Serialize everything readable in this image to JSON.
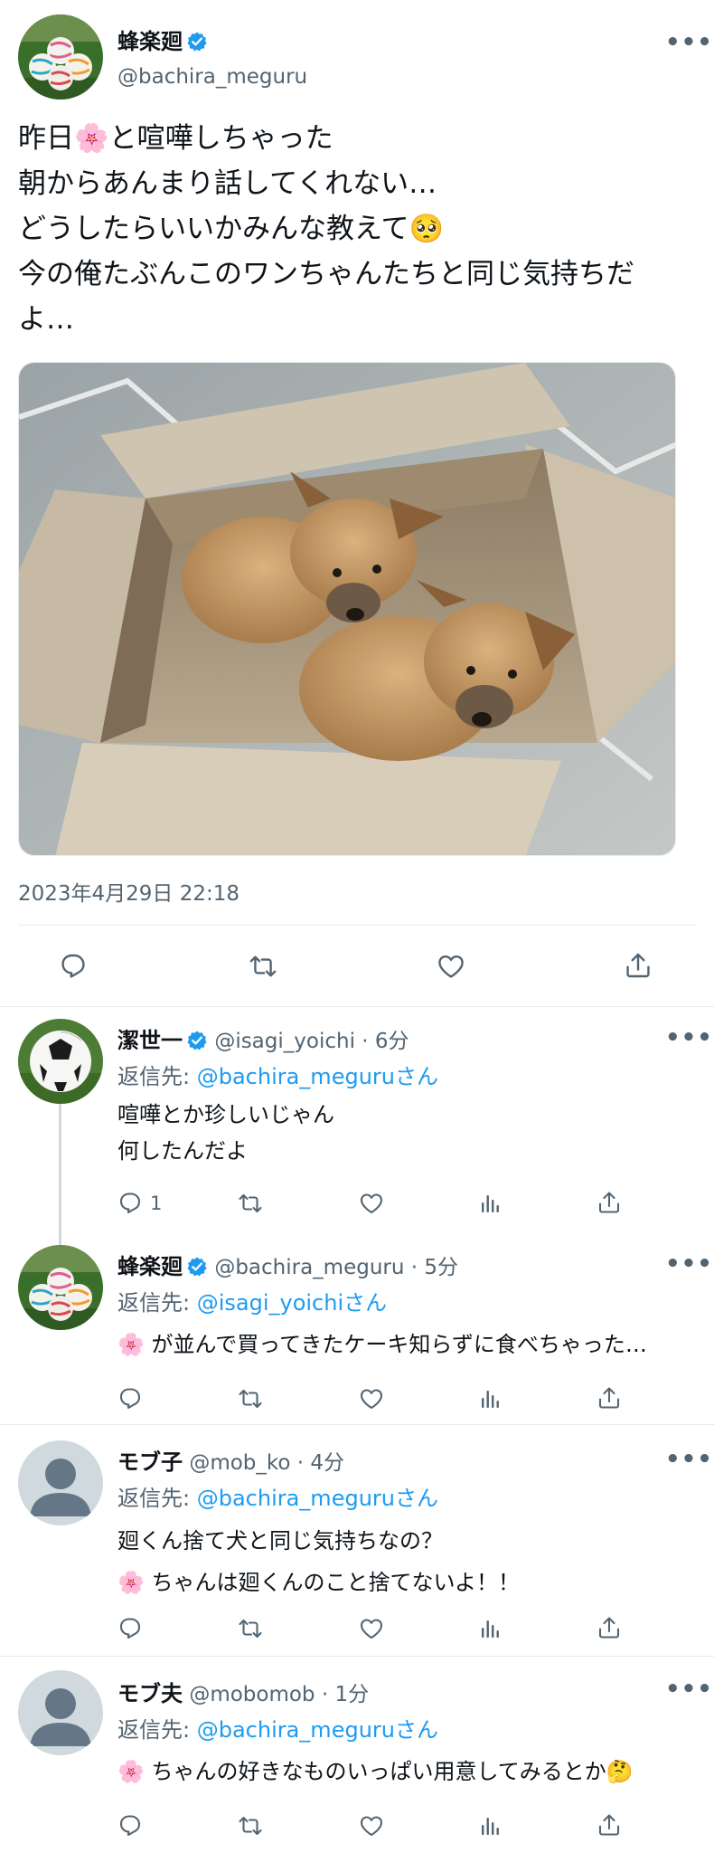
{
  "main_tweet": {
    "name": "蜂楽廻",
    "handle": "@bachira_meguru",
    "more": "•••",
    "lines": [
      "昨日🌸と喧嘩しちゃった",
      "朝からあんまり話してくれない…",
      "どうしたらいいかみんな教えて🥺",
      "今の俺たぶんこのワンちゃんたちと同じ気持ちだ",
      "よ…"
    ],
    "timestamp": "2023年4月29日 22:18",
    "actions": [
      "reply-icon",
      "retweet-icon",
      "like-icon",
      "share-icon"
    ]
  },
  "replies": [
    {
      "name": "潔世一",
      "handle": "@isagi_yoichi",
      "time": "6分",
      "verified": true,
      "reply_to_prefix": "返信先: ",
      "reply_to_handle": "@bachira_meguruさん",
      "lines": [
        "喧嘩とか珍しいじゃん",
        "何したんだよ"
      ],
      "reply_count": "1"
    },
    {
      "name": "蜂楽廻",
      "handle": "@bachira_meguru",
      "time": "5分",
      "verified": true,
      "reply_to_prefix": "返信先: ",
      "reply_to_handle": "@isagi_yoichiさん",
      "lines": [
        "🌸 が並んで買ってきたケーキ知らずに食べちゃった…"
      ],
      "reply_count": ""
    },
    {
      "name": "モブ子",
      "handle": "@mob_ko",
      "time": "4分",
      "verified": false,
      "reply_to_prefix": "返信先: ",
      "reply_to_handle": "@bachira_meguruさん",
      "lines": [
        "廻くん捨て犬と同じ気持ちなの？",
        "🌸 ちゃんは廻くんのこと捨てないよ！！"
      ],
      "reply_count": ""
    },
    {
      "name": "モブ夫",
      "handle": "@mobomob",
      "time": "1分",
      "verified": false,
      "reply_to_prefix": "返信先: ",
      "reply_to_handle": "@bachira_meguruさん",
      "lines": [
        "🌸 ちゃんの好きなものいっぱい用意してみるとか🤔"
      ],
      "reply_count": ""
    }
  ],
  "colors": {
    "link": "#1d9bf0",
    "muted": "#536471",
    "divider": "#e6e9ec"
  }
}
